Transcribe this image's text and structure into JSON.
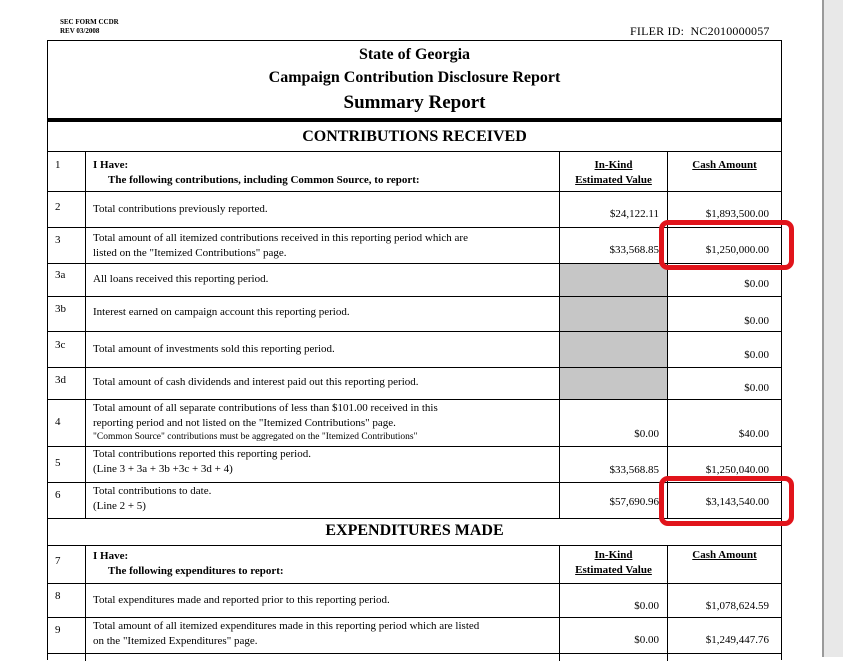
{
  "form": {
    "id_line1": "SEC FORM CCDR",
    "id_line2": "REV 03/2008",
    "filer_label": "FILER ID:",
    "filer_id": "NC2010000057"
  },
  "header": {
    "state": "State of Georgia",
    "report": "Campaign Contribution Disclosure Report",
    "summary": "Summary Report"
  },
  "contributions": {
    "title": "CONTRIBUTIONS RECEIVED",
    "intro_num": "1",
    "intro_line1": "I Have:",
    "intro_line2": "The following contributions, including Common Source, to report:",
    "col_inkind_1": "In-Kind",
    "col_inkind_2": "Estimated Value",
    "col_cash": "Cash Amount",
    "rows": [
      {
        "num": "2",
        "line1": "Total contributions previously reported.",
        "line2": "",
        "inkind": "$24,122.11",
        "cash": "$1,893,500.00"
      },
      {
        "num": "3",
        "line1": "Total amount of all itemized contributions received in this reporting period which are",
        "line2": "listed on the \"Itemized Contributions\" page.",
        "inkind": "$33,568.85",
        "cash": "$1,250,000.00"
      },
      {
        "num": "3a",
        "line1": "All loans received this reporting period.",
        "line2": "",
        "inkind": "",
        "cash": "$0.00"
      },
      {
        "num": "3b",
        "line1": "Interest earned on campaign account this reporting period.",
        "line2": "",
        "inkind": "",
        "cash": "$0.00"
      },
      {
        "num": "3c",
        "line1": "Total amount of investments sold this reporting period.",
        "line2": "",
        "inkind": "",
        "cash": "$0.00"
      },
      {
        "num": "3d",
        "line1": "Total amount of cash dividends and interest paid out this reporting period.",
        "line2": "",
        "inkind": "",
        "cash": "$0.00"
      },
      {
        "num": "4",
        "line1": "Total amount of all separate contributions of less than $101.00 received in this",
        "line2": "reporting period and not listed on the \"Itemized Contributions\" page.",
        "line3": "\"Common Source\" contributions must be aggregated on the \"Itemized Contributions\"",
        "inkind": "$0.00",
        "cash": "$40.00"
      },
      {
        "num": "5",
        "line1": "Total contributions reported this reporting period.",
        "line2": "(Line 3 + 3a + 3b +3c + 3d + 4)",
        "inkind": "$33,568.85",
        "cash": "$1,250,040.00"
      },
      {
        "num": "6",
        "line1": "Total contributions to date.",
        "line2": "(Line 2 + 5)",
        "inkind": "$57,690.96",
        "cash": "$3,143,540.00"
      }
    ]
  },
  "expenditures": {
    "title": "EXPENDITURES MADE",
    "intro_num": "7",
    "intro_line1": "I Have:",
    "intro_line2": "The following expenditures to report:",
    "col_inkind_1": "In-Kind",
    "col_inkind_2": "Estimated Value",
    "col_cash": "Cash Amount",
    "rows": [
      {
        "num": "8",
        "line1": "Total expenditures made and reported prior to this reporting period.",
        "line2": "",
        "inkind": "$0.00",
        "cash": "$1,078,624.59"
      },
      {
        "num": "9",
        "line1": "Total amount of all itemized expenditures made in this reporting period which are listed",
        "line2": "on the \"Itemized Expenditures\" page.",
        "inkind": "$0.00",
        "cash": "$1,249,447.76"
      }
    ]
  },
  "annotations": {
    "highlight_color": "#e1141b"
  }
}
